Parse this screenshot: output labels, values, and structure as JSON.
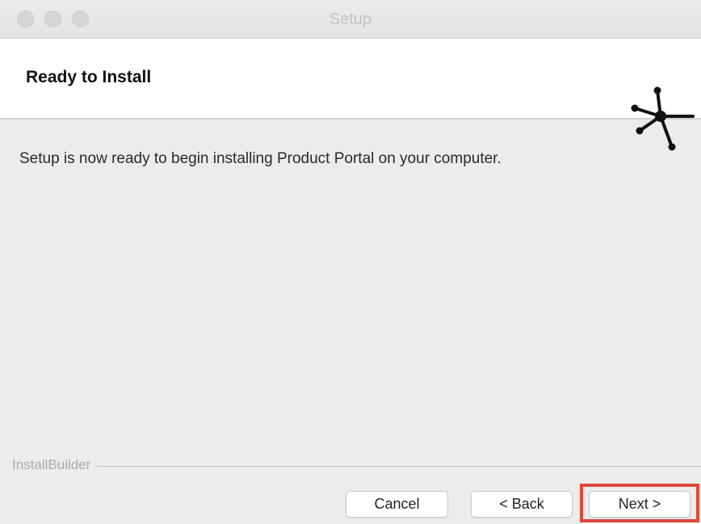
{
  "window": {
    "title": "Setup"
  },
  "header": {
    "title": "Ready to Install",
    "logo_icon": "installbuilder-logo-icon"
  },
  "content": {
    "message": "Setup is now ready to begin installing Product Portal on your computer."
  },
  "footer": {
    "brand": "InstallBuilder",
    "buttons": {
      "cancel": "Cancel",
      "back": "< Back",
      "next": "Next >"
    },
    "highlight_color": "#e0483a"
  }
}
